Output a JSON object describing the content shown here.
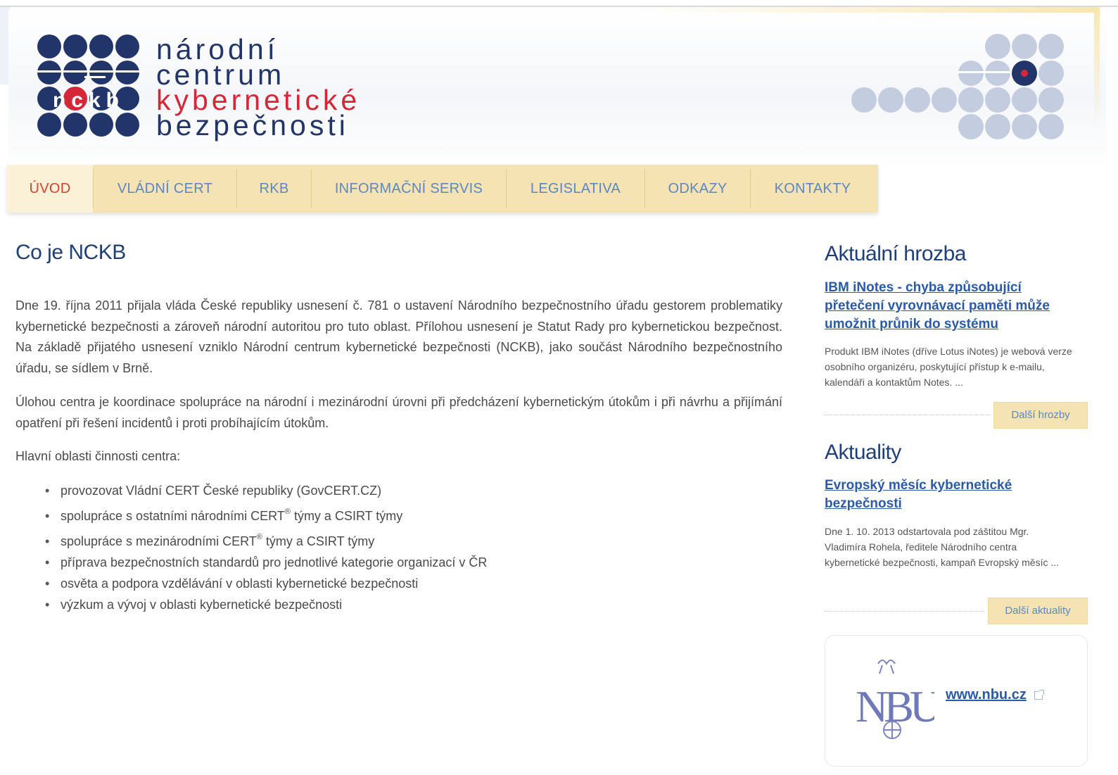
{
  "logo": {
    "line1": "národní",
    "line2": "centrum",
    "line3": "kybernetické",
    "line4": "bezpečnosti",
    "badge_text": "nckb"
  },
  "nav": {
    "items": [
      {
        "label": "ÚVOD",
        "active": true
      },
      {
        "label": "VLÁDNÍ CERT",
        "active": false
      },
      {
        "label": "RKB",
        "active": false
      },
      {
        "label": "INFORMAČNÍ SERVIS",
        "active": false
      },
      {
        "label": "LEGISLATIVA",
        "active": false
      },
      {
        "label": "ODKAZY",
        "active": false
      },
      {
        "label": "KONTAKTY",
        "active": false
      }
    ]
  },
  "main": {
    "title": "Co je NCKB",
    "para1": "Dne 19. října 2011 přijala vláda České republiky usnesení č. 781 o ustavení Národního bezpečnostního úřadu gestorem problematiky kybernetické bezpečnosti a zároveň národní autoritou pro tuto oblast. Přílohou usnesení je Statut Rady pro kybernetickou bezpečnost. Na základě přijatého usnesení vzniklo Národní centrum kybernetické bezpečnosti (NCKB), jako součást Národního bezpečnostního úřadu, se sídlem v Brně.",
    "para2": "Úlohou centra je koordinace spolupráce na národní i mezinárodní úrovni při předcházení kybernetickým útokům i při návrhu a přijímání opatření při řešení incidentů i proti probíhajícím útokům.",
    "intro": "Hlavní oblasti činnosti centra:",
    "bullets": [
      "provozovat Vládní CERT České republiky (GovCERT.CZ)",
      "spolupráce s ostatními národními CERT",
      "týmy a CSIRT týmy",
      "spolupráce s mezinárodními CERT",
      "týmy a CSIRT týmy",
      "příprava bezpečnostních standardů pro jednotlivé kategorie organizací v ČR",
      "osvěta a podpora vzdělávání v oblasti kybernetické bezpečnosti",
      "výzkum a vývoj v oblasti kybernetické bezpečnosti"
    ],
    "reg_mark": "®"
  },
  "sidebar": {
    "threat_heading": "Aktuální hrozba",
    "threat_link": "IBM iNotes - chyba způsobující přetečení vyrovnávací paměti může umožnit průnik do systému",
    "threat_text": "Produkt IBM iNotes (dříve Lotus iNotes) je webová verze osobního organizéru, poskytující přístup k e-mailu, kalendáři a kontaktům Notes. ...",
    "threat_more": "Další hrozby",
    "news_heading": "Aktuality",
    "news_link": "Evropský měsíc kybernetické bezpečnosti",
    "news_text": "Dne 1. 10. 2013 odstartovala pod záštitou Mgr. Vladimíra Rohela, ředitele Národního centra kybernetické bezpečnosti, kampaň Evropský měsíc ...",
    "news_more": "Další aktuality",
    "nbu_link": "www.nbu.cz",
    "nbu_logo_text": "NBU"
  },
  "colors": {
    "navy": "#22356b",
    "red": "#d62738",
    "nav_bg": "#f6e3b4",
    "link_blue": "#2a5aa8",
    "dot_grey": "#c4cde0"
  }
}
